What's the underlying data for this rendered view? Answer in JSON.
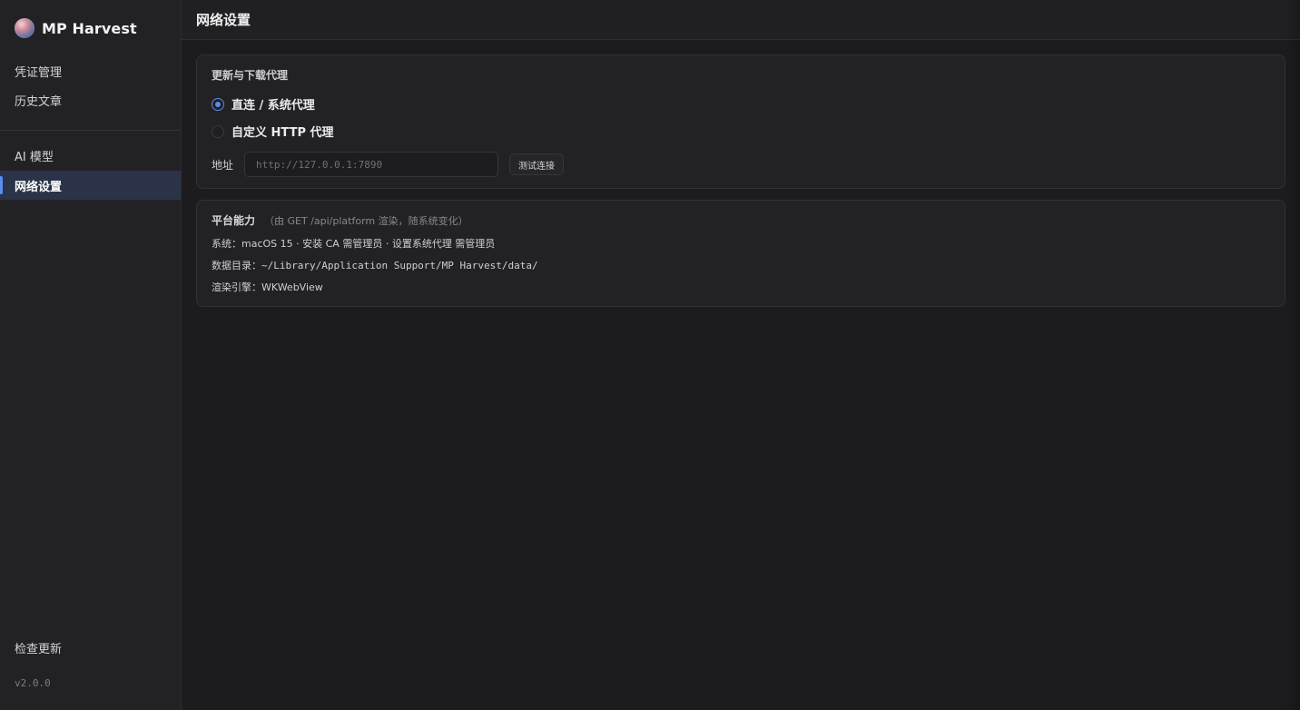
{
  "app": {
    "name": "MP Harvest",
    "version": "v2.0.0"
  },
  "sidebar": {
    "items": [
      {
        "label": "凭证管理"
      },
      {
        "label": "历史文章"
      },
      {
        "label": "AI 模型"
      },
      {
        "label": "网络设置",
        "active": true
      }
    ],
    "footer": {
      "check_update": "检查更新"
    }
  },
  "page": {
    "title": "网络设置"
  },
  "proxy": {
    "title": "更新与下载代理",
    "options": [
      {
        "label": "直连 / 系统代理",
        "selected": true
      },
      {
        "label": "自定义 HTTP 代理",
        "selected": false
      }
    ],
    "address_label": "地址",
    "address_placeholder": "http://127.0.0.1:7890",
    "address_value": "",
    "test_button": "测试连接"
  },
  "platform": {
    "title": "平台能力",
    "note": "（由 GET /api/platform 渲染，随系统变化）",
    "system_label": "系统：",
    "system_value": "macOS 15 · 安装 CA 需管理员 · 设置系统代理 需管理员",
    "data_dir_label": "数据目录：",
    "data_dir_value": "~/Library/Application Support/MP Harvest/data/",
    "engine_label": "渲染引擎：",
    "engine_value": "WKWebView"
  },
  "colors": {
    "accent": "#5b8cf0",
    "active_bg": "#2b3348",
    "background": "#1c1c1e"
  }
}
